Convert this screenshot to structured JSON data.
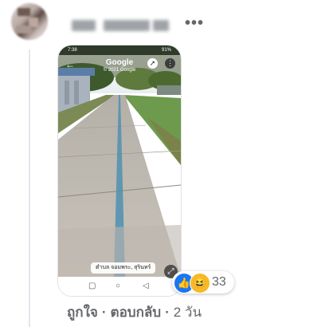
{
  "comment": {
    "more_label": "•••",
    "attachment": {
      "status_time": "7:38",
      "status_battery": "91%",
      "back_icon": "←",
      "title": "Google",
      "copyright": "© 2021 Google",
      "compass_icon": "➚",
      "menu_icon": "⋮",
      "place_label": "ตำบล จอมพระ, สุรินทร์",
      "nav_square": "▢",
      "nav_circle": "○",
      "nav_back": "◁",
      "expand_icon": "⤢"
    },
    "reactions": {
      "like_icon": "👍",
      "haha_icon": "😆",
      "count": "33"
    },
    "actions": {
      "like_label": "ถูกใจ",
      "separator": "·",
      "reply_label": "ตอบกลับ",
      "time_label": "2 วัน"
    }
  },
  "colors": {
    "background": "#ffffff",
    "meta_text": "#65676b",
    "like_blue": "#1877f2",
    "haha_yellow": "#f7b928"
  }
}
